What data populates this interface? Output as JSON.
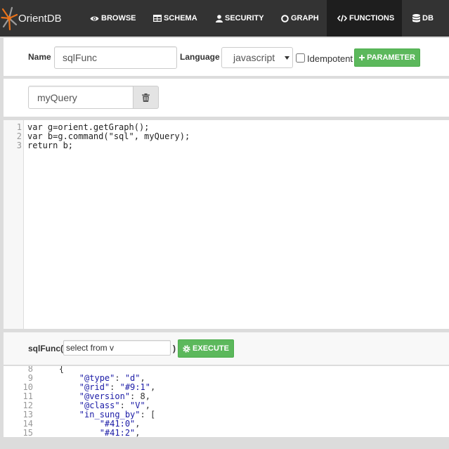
{
  "app": {
    "logo_text": "OrientDB",
    "logo_icon": "orientdb-logo-icon"
  },
  "nav": {
    "items": [
      {
        "label": "BROWSE",
        "icon": "eye-icon"
      },
      {
        "label": "SCHEMA",
        "icon": "table-icon"
      },
      {
        "label": "SECURITY",
        "icon": "user-icon"
      },
      {
        "label": "GRAPH",
        "icon": "circle-icon"
      },
      {
        "label": "FUNCTIONS",
        "icon": "code-icon",
        "active": true
      },
      {
        "label": "DB",
        "icon": "database-icon"
      }
    ]
  },
  "function_form": {
    "name_label": "Name",
    "name_value": "sqlFunc",
    "language_label": "Language",
    "language_value": "javascript",
    "language_caret_icon": "caret-down-icon",
    "idempotent_label": "Idempotent",
    "idempotent_checked": false,
    "add_parameter_label": "PARAMETER",
    "add_parameter_icon": "plus-icon"
  },
  "parameters": [
    {
      "value": "myQuery",
      "delete_icon": "trash-icon"
    }
  ],
  "editor": {
    "lines": [
      {
        "number": "1",
        "text": "var g=orient.getGraph();"
      },
      {
        "number": "2",
        "text": "var b=g.command(\"sql\", myQuery);"
      },
      {
        "number": "3",
        "text": "return b;"
      }
    ]
  },
  "execute": {
    "call_prefix": "sqlFunc(",
    "call_suffix": ")",
    "argument_value": "select from v",
    "button_label": "EXECUTE",
    "button_icon": "gear-icon"
  },
  "result": {
    "lines": [
      {
        "number": "8",
        "text": "    {"
      },
      {
        "number": "9",
        "text": "        \"@type\": \"d\","
      },
      {
        "number": "10",
        "text": "        \"@rid\": \"#9:1\","
      },
      {
        "number": "11",
        "text": "        \"@version\": 8,"
      },
      {
        "number": "12",
        "text": "        \"@class\": \"V\","
      },
      {
        "number": "13",
        "text": "        \"in_sung_by\": ["
      },
      {
        "number": "14",
        "text": "            \"#41:0\","
      },
      {
        "number": "15",
        "text": "            \"#41:2\","
      }
    ]
  },
  "colors": {
    "nav_background": "#333333",
    "nav_active_background": "#1e1e1e",
    "logo_accent": "#e8731c",
    "button_green": "#5cb85c",
    "json_string": "#1a1aa6"
  }
}
